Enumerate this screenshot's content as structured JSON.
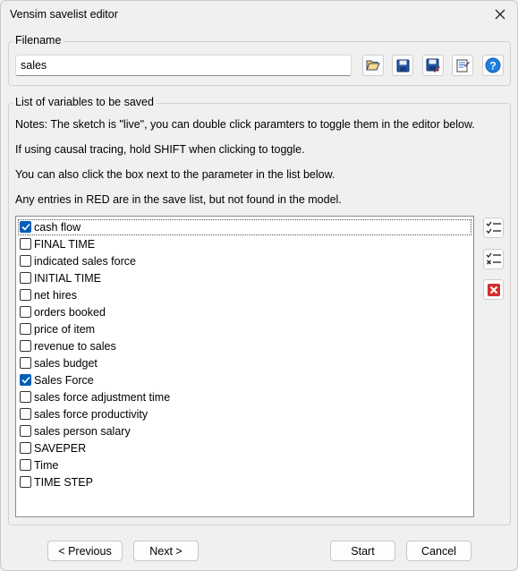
{
  "window": {
    "title": "Vensim savelist editor"
  },
  "filename_group": {
    "label": "Filename",
    "value": "sales",
    "toolbar": [
      {
        "name": "open-folder-icon"
      },
      {
        "name": "save-icon"
      },
      {
        "name": "save-as-icon"
      },
      {
        "name": "notepad-icon"
      },
      {
        "name": "help-icon"
      }
    ]
  },
  "variables_group": {
    "label": "List of variables to be saved",
    "notes": [
      "Notes: The sketch is \"live\", you can double click paramters to toggle them in the editor below.",
      "If using causal tracing, hold SHIFT when clicking to toggle.",
      "You can also click the box next to the parameter in the list below.",
      "Any entries in RED are in the save list, but not found in the model."
    ],
    "items": [
      {
        "label": "cash flow",
        "checked": true
      },
      {
        "label": "FINAL TIME",
        "checked": false
      },
      {
        "label": "indicated sales force",
        "checked": false
      },
      {
        "label": "INITIAL TIME",
        "checked": false
      },
      {
        "label": "net hires",
        "checked": false
      },
      {
        "label": "orders booked",
        "checked": false
      },
      {
        "label": "price of item",
        "checked": false
      },
      {
        "label": "revenue to sales",
        "checked": false
      },
      {
        "label": "sales budget",
        "checked": false
      },
      {
        "label": "Sales Force",
        "checked": true
      },
      {
        "label": "sales force adjustment time",
        "checked": false
      },
      {
        "label": "sales force productivity",
        "checked": false
      },
      {
        "label": "sales person salary",
        "checked": false
      },
      {
        "label": "SAVEPER",
        "checked": false
      },
      {
        "label": "Time",
        "checked": false
      },
      {
        "label": "TIME STEP",
        "checked": false
      }
    ],
    "side_buttons": [
      {
        "name": "check-all-icon"
      },
      {
        "name": "uncheck-all-icon"
      },
      {
        "name": "delete-icon"
      }
    ]
  },
  "footer": {
    "previous": "< Previous",
    "next": "Next >",
    "start": "Start",
    "cancel": "Cancel"
  },
  "colors": {
    "accent": "#005fb8",
    "help": "#1f7fe0",
    "delete": "#d42d2d"
  }
}
